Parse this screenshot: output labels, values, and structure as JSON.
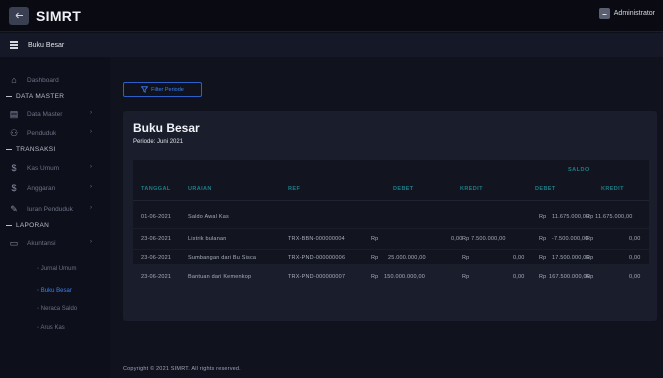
{
  "app": {
    "title": "SIMRT",
    "user": "Administrator"
  },
  "header": {
    "page": "Buku Besar"
  },
  "sidebar": {
    "dashboard": "Dashboard",
    "data_master_section": "DATA MASTER",
    "data_master": "Data Master",
    "penduduk": "Penduduk",
    "transaksi_section": "TRANSAKSI",
    "kas_umum": "Kas Umum",
    "anggaran": "Anggaran",
    "iuran_penduduk": "Iuran Penduduk",
    "laporan_section": "LAPORAN",
    "akuntansi": "Akuntansi",
    "sub": [
      "Jurnal Umum",
      "Buku Besar",
      "Neraca Saldo",
      "Arus Kas"
    ]
  },
  "main": {
    "filter_label": "Filter Periode",
    "title": "Buku Besar",
    "period": "Periode: Juni 2021"
  },
  "table": {
    "saldo_header": "SALDO",
    "columns": {
      "tanggal": "TANGGAL",
      "uraian": "URAIAN",
      "ref": "REF",
      "debet": "DEBET",
      "kredit": "KREDIT",
      "saldo_debet": "DEBET",
      "saldo_kredit": "KREDIT"
    },
    "rows": [
      {
        "tanggal": "01-06-2021",
        "uraian": "Saldo Awal Kas",
        "ref": "",
        "debet_rp": "",
        "debet": "",
        "kredit_rp": "",
        "kredit": "",
        "sd_rp": "Rp",
        "sd": "11.675.000,00",
        "sk_rp": "",
        "sk": "Rp 11.675.000,00"
      },
      {
        "tanggal": "23-06-2021",
        "uraian": "Listrik bulanan",
        "ref": "TRX-BBN-000000004",
        "debet_rp": "Rp",
        "debet": "0,00",
        "kredit_rp": "",
        "kredit": "Rp 7.500.000,00",
        "sd_rp": "Rp",
        "sd": "-7.500.000,00",
        "sk_rp": "Rp",
        "sk": "0,00"
      },
      {
        "tanggal": "23-06-2021",
        "uraian": "Sumbangan dari Bu Sisca",
        "ref": "TRX-PND-000000006",
        "debet_rp": "Rp",
        "debet": "25.000.000,00",
        "kredit_rp": "Rp",
        "kredit": "0,00",
        "sd_rp": "Rp",
        "sd": "17.500.000,00",
        "sk_rp": "Rp",
        "sk": "0,00"
      },
      {
        "tanggal": "23-06-2021",
        "uraian": "Bantuan dari Kemenkop",
        "ref": "TRX-PND-000000007",
        "debet_rp": "Rp",
        "debet": "150.000.000,00",
        "kredit_rp": "Rp",
        "kredit": "0,00",
        "sd_rp": "Rp",
        "sd": "167.500.000,00",
        "sk_rp": "Rp",
        "sk": "0,00"
      }
    ]
  },
  "footer": {
    "text": "Copyright © 2021 SIMRT. All rights reserved."
  }
}
